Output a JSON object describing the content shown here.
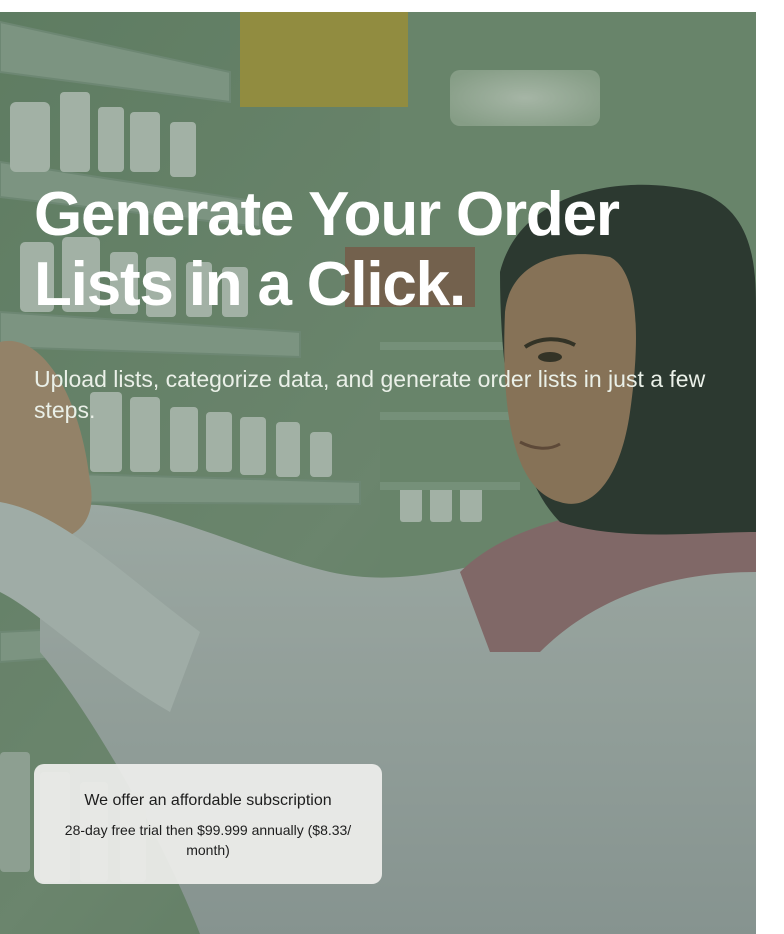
{
  "hero": {
    "headline": "Generate Your Order Lists in a Click.",
    "subtitle": "Upload lists, categorize data, and generate order lists in just a few steps.",
    "overlay_color": "#2e4a34",
    "image_description_name": "pharmacist-photo"
  },
  "subscription_card": {
    "title": "We offer an affordable subscription",
    "body": "28-day free trial then $99.999 annually ($8.33/ month)",
    "background": "#eeeeec"
  }
}
